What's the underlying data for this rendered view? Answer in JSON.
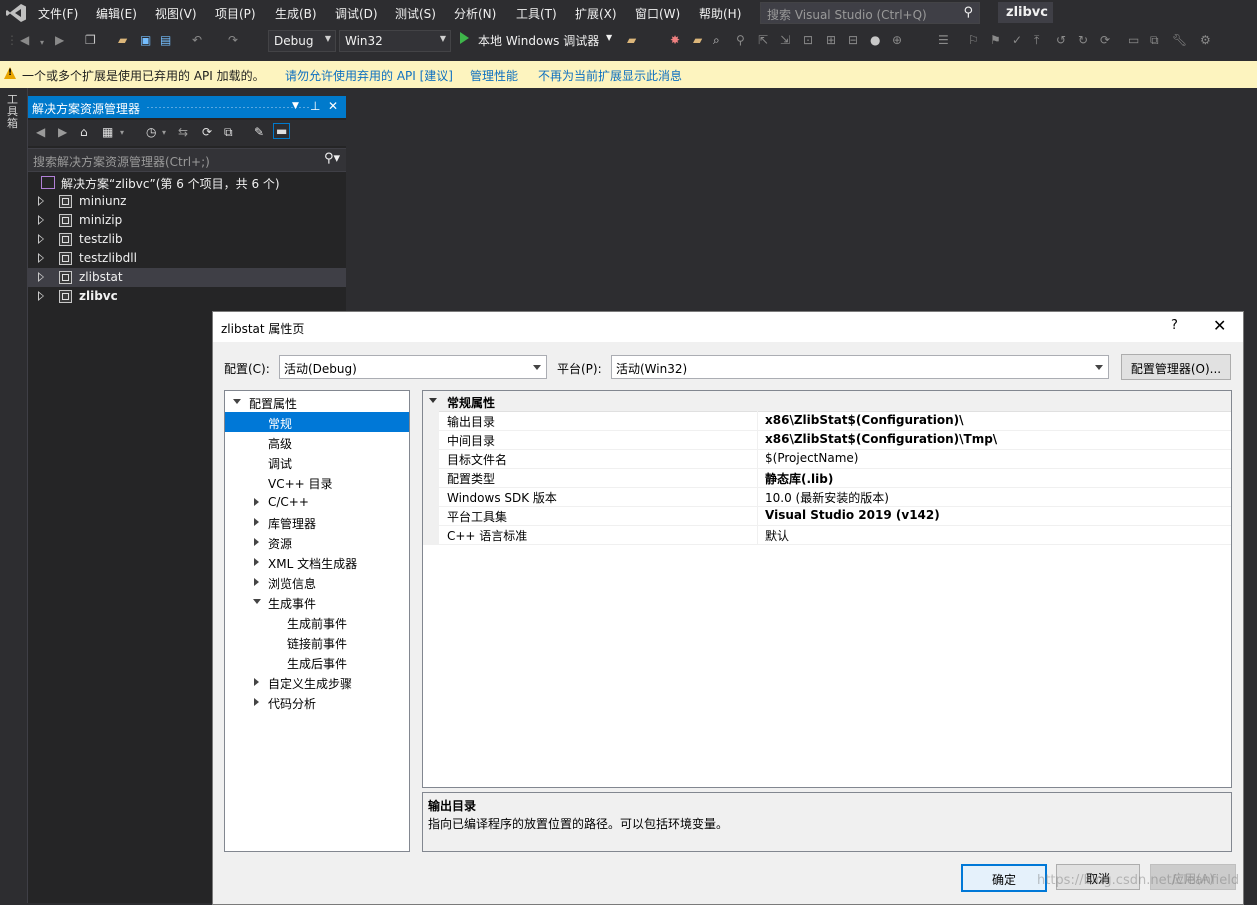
{
  "menubar": {
    "items": [
      "文件(F)",
      "编辑(E)",
      "视图(V)",
      "项目(P)",
      "生成(B)",
      "调试(D)",
      "测试(S)",
      "分析(N)",
      "工具(T)",
      "扩展(X)",
      "窗口(W)",
      "帮助(H)"
    ],
    "search_placeholder": "搜索 Visual Studio (Ctrl+Q)",
    "solution_name": "zlibvc"
  },
  "toolbar": {
    "config": "Debug",
    "platform": "Win32",
    "run_label": "本地 Windows 调试器"
  },
  "infobar": {
    "message": "一个或多个扩展是使用已弃用的 API 加载的。",
    "link1": "请勿允许使用弃用的 API [建议]",
    "link2": "管理性能",
    "link3": "不再为当前扩展显示此消息"
  },
  "toolbox": {
    "label": "工具箱"
  },
  "solution_explorer": {
    "title": "解决方案资源管理器",
    "search_placeholder": "搜索解决方案资源管理器(Ctrl+;)",
    "solution_label": "解决方案“zlibvc”(第 6 个项目，共 6 个)",
    "projects": [
      {
        "name": "miniunz"
      },
      {
        "name": "minizip"
      },
      {
        "name": "testzlib"
      },
      {
        "name": "testzlibdll"
      },
      {
        "name": "zlibstat"
      },
      {
        "name": "zlibvc"
      }
    ],
    "selected_project": "zlibstat",
    "startup_project": "zlibvc"
  },
  "dialog": {
    "title": "zlibstat 属性页",
    "help": "?",
    "close": "✕",
    "config_label": "配置(C):",
    "config_value": "活动(Debug)",
    "platform_label": "平台(P):",
    "platform_value": "活动(Win32)",
    "config_manager": "配置管理器(O)...",
    "nav": {
      "root": "配置属性",
      "items": [
        "常规",
        "高级",
        "调试",
        "VC++ 目录"
      ],
      "collapsed": [
        "C/C++",
        "库管理器",
        "资源",
        "XML 文档生成器",
        "浏览信息"
      ],
      "build_events": "生成事件",
      "build_events_children": [
        "生成前事件",
        "链接前事件",
        "生成后事件"
      ],
      "after": [
        "自定义生成步骤",
        "代码分析"
      ],
      "selected": "常规"
    },
    "grid": {
      "category": "常规属性",
      "rows": [
        {
          "key": "输出目录",
          "value": "x86\\ZlibStat$(Configuration)\\"
        },
        {
          "key": "中间目录",
          "value": "x86\\ZlibStat$(Configuration)\\Tmp\\"
        },
        {
          "key": "目标文件名",
          "value": "$(ProjectName)"
        },
        {
          "key": "配置类型",
          "value": "静态库(.lib)"
        },
        {
          "key": "Windows SDK 版本",
          "value": "10.0 (最新安装的版本)"
        },
        {
          "key": "平台工具集",
          "value": "Visual Studio 2019 (v142)"
        },
        {
          "key": "C++ 语言标准",
          "value": "默认"
        }
      ]
    },
    "description": {
      "title": "输出目录",
      "text": "指向已编译程序的放置位置的路径。可以包括环境变量。"
    },
    "buttons": {
      "ok": "确定",
      "cancel": "取消",
      "apply": "应用(A)"
    }
  },
  "watermark": "https://blog.csdn.net/cleanfield",
  "colors": {
    "accent": "#007acc",
    "selection": "#0078d7",
    "run": "#3eb54a",
    "infobar": "#fdf4bf",
    "link": "#0e70c0"
  }
}
